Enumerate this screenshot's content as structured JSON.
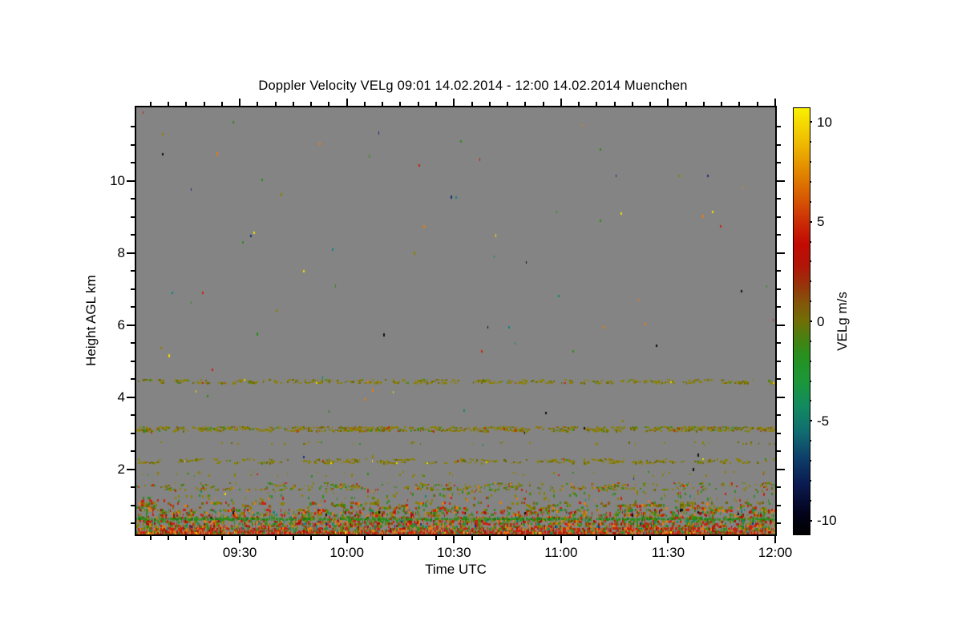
{
  "title": "Doppler Velocity VELg   09:01 14.02.2014 - 12:00 14.02.2014 Muenchen",
  "axes": {
    "x": {
      "label": "Time UTC",
      "start": "09:01",
      "end": "12:00",
      "start_min": 541,
      "end_min": 720,
      "minor_step_min": 5,
      "major_ticks": [
        {
          "min": 570,
          "label": "09:30"
        },
        {
          "min": 600,
          "label": "10:00"
        },
        {
          "min": 630,
          "label": "10:30"
        },
        {
          "min": 660,
          "label": "11:00"
        },
        {
          "min": 690,
          "label": "11:30"
        },
        {
          "min": 720,
          "label": "12:00"
        }
      ]
    },
    "y": {
      "label": "Height AGL km",
      "min_km": 0.2,
      "max_km": 12.04,
      "minor_step_km": 0.5,
      "major_ticks": [
        {
          "km": 2,
          "label": "2"
        },
        {
          "km": 4,
          "label": "4"
        },
        {
          "km": 6,
          "label": "6"
        },
        {
          "km": 8,
          "label": "8"
        },
        {
          "km": 10,
          "label": "10"
        }
      ]
    }
  },
  "colorbar": {
    "label": "VELg m/s",
    "min": -10.7,
    "max": 10.7,
    "minor_step": 1,
    "major_ticks": [
      {
        "v": 10,
        "label": "10"
      },
      {
        "v": 5,
        "label": "5"
      },
      {
        "v": 0,
        "label": "0"
      },
      {
        "v": -5,
        "label": "-5"
      },
      {
        "v": -10,
        "label": "-10"
      }
    ],
    "gradient_stops": [
      {
        "t": 0.0,
        "color": "#000000"
      },
      {
        "t": 0.05,
        "color": "#03031c"
      },
      {
        "t": 0.12,
        "color": "#0a1b52"
      },
      {
        "t": 0.18,
        "color": "#0e3e6a"
      },
      {
        "t": 0.24,
        "color": "#106c70"
      },
      {
        "t": 0.3,
        "color": "#128a60"
      },
      {
        "t": 0.36,
        "color": "#1b9739"
      },
      {
        "t": 0.42,
        "color": "#27901e"
      },
      {
        "t": 0.47,
        "color": "#517d0e"
      },
      {
        "t": 0.5,
        "color": "#706f06"
      },
      {
        "t": 0.545,
        "color": "#84540a"
      },
      {
        "t": 0.585,
        "color": "#97330a"
      },
      {
        "t": 0.63,
        "color": "#b11508"
      },
      {
        "t": 0.68,
        "color": "#c10a04"
      },
      {
        "t": 0.73,
        "color": "#ca2a06"
      },
      {
        "t": 0.79,
        "color": "#d75a02"
      },
      {
        "t": 0.86,
        "color": "#e48e00"
      },
      {
        "t": 0.92,
        "color": "#efbc00"
      },
      {
        "t": 1.0,
        "color": "#f9f000"
      }
    ]
  },
  "chart_data": {
    "type": "heatmap",
    "title": "Doppler Velocity VELg   09:01 14.02.2014 - 12:00 14.02.2014 Muenchen",
    "xlabel": "Time UTC",
    "ylabel": "Height AGL km",
    "x_range": [
      "09:01",
      "12:00"
    ],
    "y_range_km": [
      0.2,
      12.04
    ],
    "value_label": "VELg m/s",
    "value_range": [
      -10.7,
      10.7
    ],
    "no_data_color": "#848484",
    "seed": 20140214,
    "palette": {
      "olive": "#8b8000",
      "dark_olive": "#6e6900",
      "brown": "#8f5a0e",
      "green": "#2f8c1a",
      "dark_green": "#1e7a10",
      "red": "#c9230e",
      "dark_red": "#9e1408",
      "orange": "#e07c14",
      "yellow": "#eed900",
      "teal": "#0f8878",
      "navy": "#1c2f7e",
      "black": "#0d0d0d"
    },
    "noise_layers": [
      {
        "name": "clear-air-speckle",
        "km": [
          0.2,
          12.0
        ],
        "type": "speckle",
        "density": 0.0015,
        "run": 0,
        "cell": [
          2,
          3
        ],
        "colors": [
          [
            "green",
            2
          ],
          [
            "teal",
            2
          ],
          [
            "orange",
            2
          ],
          [
            "yellow",
            1.5
          ],
          [
            "black",
            1.5
          ],
          [
            "red",
            1.5
          ],
          [
            "navy",
            1
          ],
          [
            "olive",
            1
          ],
          [
            "dark_green",
            0.5
          ]
        ]
      },
      {
        "name": "aerosol-layer-4p45km",
        "km": [
          4.4,
          4.5
        ],
        "type": "dash",
        "density": 0.16,
        "run": 0.45,
        "cell": [
          2,
          2
        ],
        "colors": [
          [
            "olive",
            8
          ],
          [
            "dark_olive",
            3
          ],
          [
            "green",
            0.5
          ],
          [
            "red",
            0.3
          ],
          [
            "yellow",
            0.2
          ]
        ]
      },
      {
        "name": "aerosol-layer-3p1km",
        "km": [
          3.06,
          3.2
        ],
        "type": "dash",
        "density": 0.3,
        "run": 0.5,
        "cell": [
          2,
          2
        ],
        "colors": [
          [
            "olive",
            8
          ],
          [
            "dark_olive",
            3
          ],
          [
            "brown",
            1.5
          ],
          [
            "green",
            1
          ],
          [
            "red",
            0.3
          ]
        ]
      },
      {
        "name": "aerosol-layer-2p75km",
        "km": [
          2.7,
          2.78
        ],
        "type": "speckle",
        "density": 0.05,
        "run": 0.2,
        "cell": [
          2,
          2
        ],
        "colors": [
          [
            "olive",
            6
          ],
          [
            "dark_olive",
            2
          ],
          [
            "green",
            0.5
          ]
        ]
      },
      {
        "name": "aerosol-layer-2p25km",
        "km": [
          2.18,
          2.3
        ],
        "type": "dash",
        "density": 0.14,
        "run": 0.55,
        "cell": [
          2,
          2
        ],
        "colors": [
          [
            "olive",
            7
          ],
          [
            "dark_olive",
            3
          ],
          [
            "green",
            0.4
          ],
          [
            "red",
            0.3
          ],
          [
            "yellow",
            0.2
          ]
        ]
      },
      {
        "name": "aerosol-layer-1p9km",
        "km": [
          1.82,
          1.95
        ],
        "type": "speckle",
        "density": 0.045,
        "run": 0.1,
        "cell": [
          2,
          2
        ],
        "colors": [
          [
            "olive",
            5
          ],
          [
            "green",
            1
          ],
          [
            "red",
            0.5
          ]
        ]
      },
      {
        "name": "aerosol-layer-1p55km",
        "km": [
          1.45,
          1.65
        ],
        "type": "dash",
        "density": 0.13,
        "run": 0.4,
        "cell": [
          2,
          2
        ],
        "colors": [
          [
            "olive",
            5
          ],
          [
            "dark_olive",
            2
          ],
          [
            "green",
            2
          ],
          [
            "red",
            1
          ],
          [
            "orange",
            0.5
          ]
        ]
      },
      {
        "name": "boundary-zone-1p2km",
        "km": [
          1.1,
          1.45
        ],
        "type": "speckle",
        "density": 0.07,
        "run": 0.1,
        "cell": [
          2,
          3
        ],
        "colors": [
          [
            "olive",
            4
          ],
          [
            "green",
            3
          ],
          [
            "red",
            2
          ],
          [
            "orange",
            0.8
          ],
          [
            "teal",
            0.3
          ],
          [
            "yellow",
            0.2
          ]
        ]
      },
      {
        "name": "boundary-zone-1km",
        "km": [
          0.9,
          1.1
        ],
        "type": "speckle",
        "density": 0.22,
        "run": 0.3,
        "cell": [
          3,
          3
        ],
        "colors": [
          [
            "olive",
            4
          ],
          [
            "dark_olive",
            2
          ],
          [
            "brown",
            2
          ],
          [
            "green",
            2.5
          ],
          [
            "red",
            2
          ],
          [
            "orange",
            1
          ]
        ]
      },
      {
        "name": "boundary-zone-0p8km",
        "km": [
          0.66,
          0.9
        ],
        "type": "speckle",
        "density": 0.34,
        "run": 0.3,
        "cell": [
          2,
          3
        ],
        "colors": [
          [
            "green",
            3
          ],
          [
            "red",
            3
          ],
          [
            "olive",
            2.5
          ],
          [
            "orange",
            1.2
          ],
          [
            "teal",
            0.5
          ],
          [
            "black",
            0.2
          ],
          [
            "dark_red",
            1
          ]
        ]
      },
      {
        "name": "green-line-0p63km",
        "km": [
          0.6,
          0.66
        ],
        "type": "line",
        "density": 0.85,
        "run": 0.1,
        "cell": [
          2,
          3
        ],
        "colors": [
          [
            "green",
            8
          ],
          [
            "dark_green",
            3
          ],
          [
            "olive",
            1
          ],
          [
            "red",
            0.4
          ]
        ]
      },
      {
        "name": "surface-zone-0p5km",
        "km": [
          0.4,
          0.6
        ],
        "type": "speckle",
        "density": 0.5,
        "run": 0.25,
        "cell": [
          2,
          3
        ],
        "colors": [
          [
            "red",
            3.5
          ],
          [
            "green",
            3
          ],
          [
            "orange",
            1.5
          ],
          [
            "olive",
            2
          ],
          [
            "teal",
            0.4
          ],
          [
            "dark_red",
            1
          ],
          [
            "navy",
            0.15
          ]
        ]
      },
      {
        "name": "surface-zone-0p33km",
        "km": [
          0.28,
          0.4
        ],
        "type": "speckle",
        "density": 0.68,
        "run": 0.3,
        "cell": [
          2,
          3
        ],
        "colors": [
          [
            "red",
            4
          ],
          [
            "orange",
            2
          ],
          [
            "green",
            2.3
          ],
          [
            "olive",
            1
          ],
          [
            "dark_red",
            1.2
          ],
          [
            "teal",
            0.3
          ]
        ]
      },
      {
        "name": "surface-band",
        "km": [
          0.2,
          0.28
        ],
        "type": "speckle",
        "density": 0.82,
        "run": 0.3,
        "cell": [
          2,
          3
        ],
        "colors": [
          [
            "red",
            5
          ],
          [
            "orange",
            2.5
          ],
          [
            "green",
            1.5
          ],
          [
            "teal",
            0.5
          ],
          [
            "yellow",
            0.3
          ],
          [
            "dark_red",
            1.5
          ]
        ]
      }
    ]
  }
}
